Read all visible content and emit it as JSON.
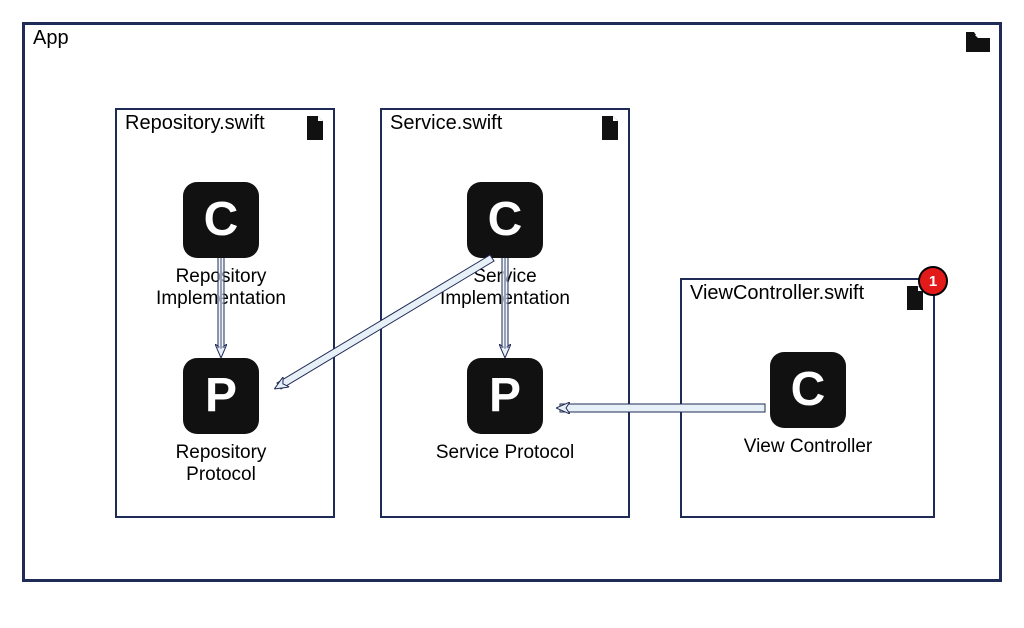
{
  "diagram": {
    "package": {
      "name": "App",
      "icon": "folder-icon"
    },
    "files": [
      {
        "name": "Repository.swift",
        "icon": "file-icon",
        "nodes": [
          {
            "kind": "C",
            "label": "Repository Implementation"
          },
          {
            "kind": "P",
            "label": "Repository Protocol"
          }
        ]
      },
      {
        "name": "Service.swift",
        "icon": "file-icon",
        "nodes": [
          {
            "kind": "C",
            "label": "Service Implementation"
          },
          {
            "kind": "P",
            "label": "Service Protocol"
          }
        ]
      },
      {
        "name": "ViewController.swift",
        "icon": "file-icon",
        "badge": "1",
        "nodes": [
          {
            "kind": "C",
            "label": "View Controller"
          }
        ]
      }
    ],
    "dependencies": [
      {
        "from": "RepositoryImplementation",
        "to": "RepositoryProtocol"
      },
      {
        "from": "ServiceImplementation",
        "to": "ServiceProtocol"
      },
      {
        "from": "ServiceImplementation",
        "to": "RepositoryProtocol"
      },
      {
        "from": "ViewController",
        "to": "ServiceProtocol"
      }
    ],
    "colors": {
      "border": "#1f2b57",
      "node_bg": "#111111",
      "node_fg": "#ffffff",
      "arrow_fill": "#e8f0f7",
      "arrow_stroke": "#1f2b57",
      "badge_bg": "#e31a1a"
    }
  }
}
